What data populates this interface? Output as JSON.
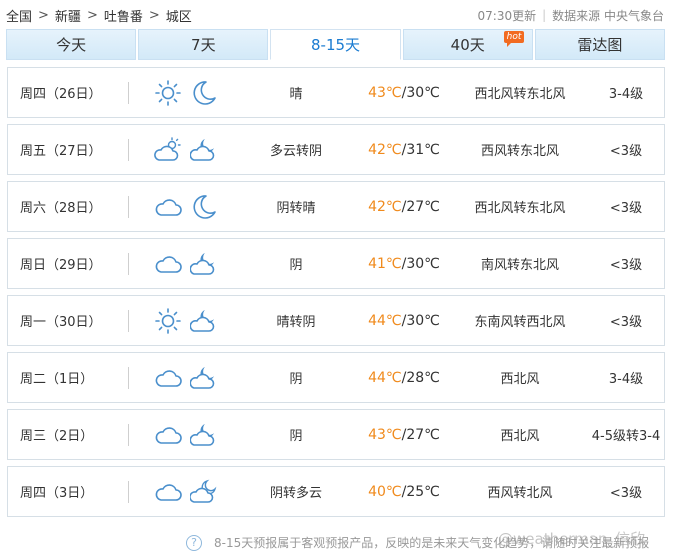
{
  "breadcrumb": {
    "items": [
      "全国",
      "新疆",
      "吐鲁番",
      "城区"
    ],
    "sep": ">"
  },
  "meta": {
    "update_time": "07:30更新",
    "source": "数据来源 中央气象台"
  },
  "tabs": [
    {
      "label": "今天",
      "active": false
    },
    {
      "label": "7天",
      "active": false
    },
    {
      "label": "8-15天",
      "active": true
    },
    {
      "label": "40天",
      "active": false,
      "badge": "hot"
    },
    {
      "label": "雷达图",
      "active": false
    }
  ],
  "forecast": [
    {
      "day": "周四（26日）",
      "icons": [
        "sunny-icon",
        "moon-icon"
      ],
      "condition": "晴",
      "high": "43℃",
      "low": "/30℃",
      "wind": "西北风转东北风",
      "level": "3-4级"
    },
    {
      "day": "周五（27日）",
      "icons": [
        "partly-cloudy-icon",
        "cloudy-night-icon"
      ],
      "condition": "多云转阴",
      "high": "42℃",
      "low": "/31℃",
      "wind": "西风转东北风",
      "level": "<3级"
    },
    {
      "day": "周六（28日）",
      "icons": [
        "overcast-icon",
        "moon-icon"
      ],
      "condition": "阴转晴",
      "high": "42℃",
      "low": "/27℃",
      "wind": "西北风转东北风",
      "level": "<3级"
    },
    {
      "day": "周日（29日）",
      "icons": [
        "overcast-icon",
        "cloudy-night-icon"
      ],
      "condition": "阴",
      "high": "41℃",
      "low": "/30℃",
      "wind": "南风转东北风",
      "level": "<3级"
    },
    {
      "day": "周一（30日）",
      "icons": [
        "sunny-icon",
        "cloudy-night-icon"
      ],
      "condition": "晴转阴",
      "high": "44℃",
      "low": "/30℃",
      "wind": "东南风转西北风",
      "level": "<3级"
    },
    {
      "day": "周二（1日）",
      "icons": [
        "overcast-icon",
        "cloudy-night-icon"
      ],
      "condition": "阴",
      "high": "44℃",
      "low": "/28℃",
      "wind": "西北风",
      "level": "3-4级"
    },
    {
      "day": "周三（2日）",
      "icons": [
        "overcast-icon",
        "cloudy-night-icon"
      ],
      "condition": "阴",
      "high": "43℃",
      "low": "/27℃",
      "wind": "西北风",
      "level": "4-5级转3-4"
    },
    {
      "day": "周四（3日）",
      "icons": [
        "overcast-icon",
        "partly-cloudy-night-icon"
      ],
      "condition": "阴转多云",
      "high": "40℃",
      "low": "/25℃",
      "wind": "西风转北风",
      "level": "<3级"
    }
  ],
  "footer": {
    "help": "?",
    "note": "8-15天预报属于客观预报产品，反映的是未来天气变化趋势，请随时关注最新预报",
    "watermark": "@weatherman_信欣"
  },
  "colors": {
    "high_temp": "#f08a1c",
    "active_tab": "#1a7bd1",
    "tab_bg": "#d9ecfa"
  }
}
